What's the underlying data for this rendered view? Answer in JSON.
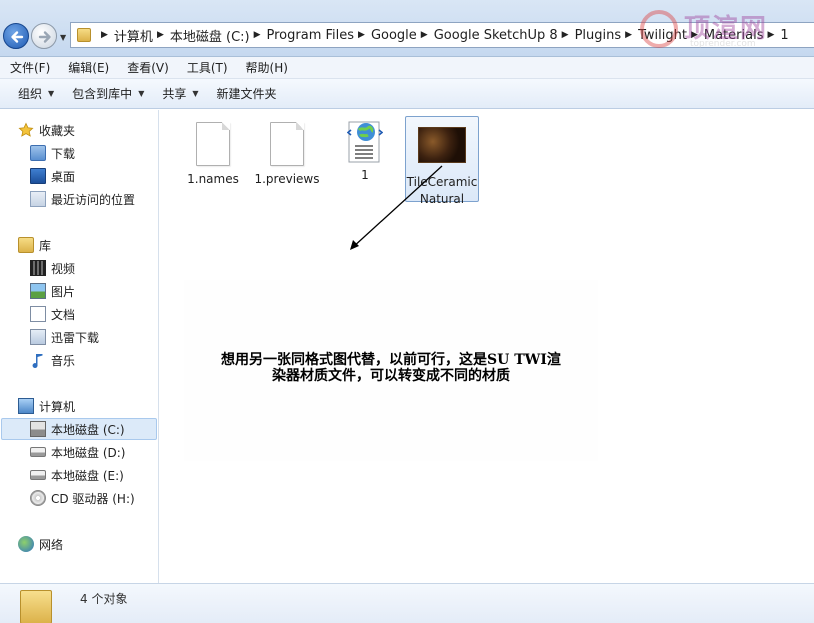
{
  "address": {
    "breadcrumbs": [
      "计算机",
      "本地磁盘 (C:)",
      "Program Files",
      "Google",
      "Google SketchUp 8",
      "Plugins",
      "Twilight",
      "Materials",
      "1"
    ]
  },
  "watermark": {
    "text": "顶渲网",
    "url": "toprender.com"
  },
  "menu": [
    "文件(F)",
    "编辑(E)",
    "查看(V)",
    "工具(T)",
    "帮助(H)"
  ],
  "toolbar": {
    "organize": "组织",
    "include_library": "包含到库中",
    "share": "共享",
    "new_folder": "新建文件夹"
  },
  "nav": {
    "favorites": "收藏夹",
    "downloads": "下载",
    "desktop": "桌面",
    "recent": "最近访问的位置",
    "libraries": "库",
    "videos": "视频",
    "pictures": "图片",
    "documents": "文档",
    "xunlei": "迅雷下载",
    "music": "音乐",
    "computer": "计算机",
    "drive_c": "本地磁盘 (C:)",
    "drive_d": "本地磁盘 (D:)",
    "drive_e": "本地磁盘 (E:)",
    "drive_h": "CD 驱动器 (H:)",
    "network": "网络"
  },
  "files": [
    {
      "name": "1.names",
      "icon": "document-icon"
    },
    {
      "name": "1.previews",
      "icon": "document-icon"
    },
    {
      "name": "1",
      "icon": "web-document-icon"
    },
    {
      "name": "TileCeramicNatural",
      "icon": "material-thumbnail"
    }
  ],
  "annotation": {
    "line1": "想用另一张同格式图代替，以前可行，这是SU   TWI渲",
    "line2": "染器材质文件，可以转变成不同的材质"
  },
  "details": {
    "count": "4 个对象"
  }
}
